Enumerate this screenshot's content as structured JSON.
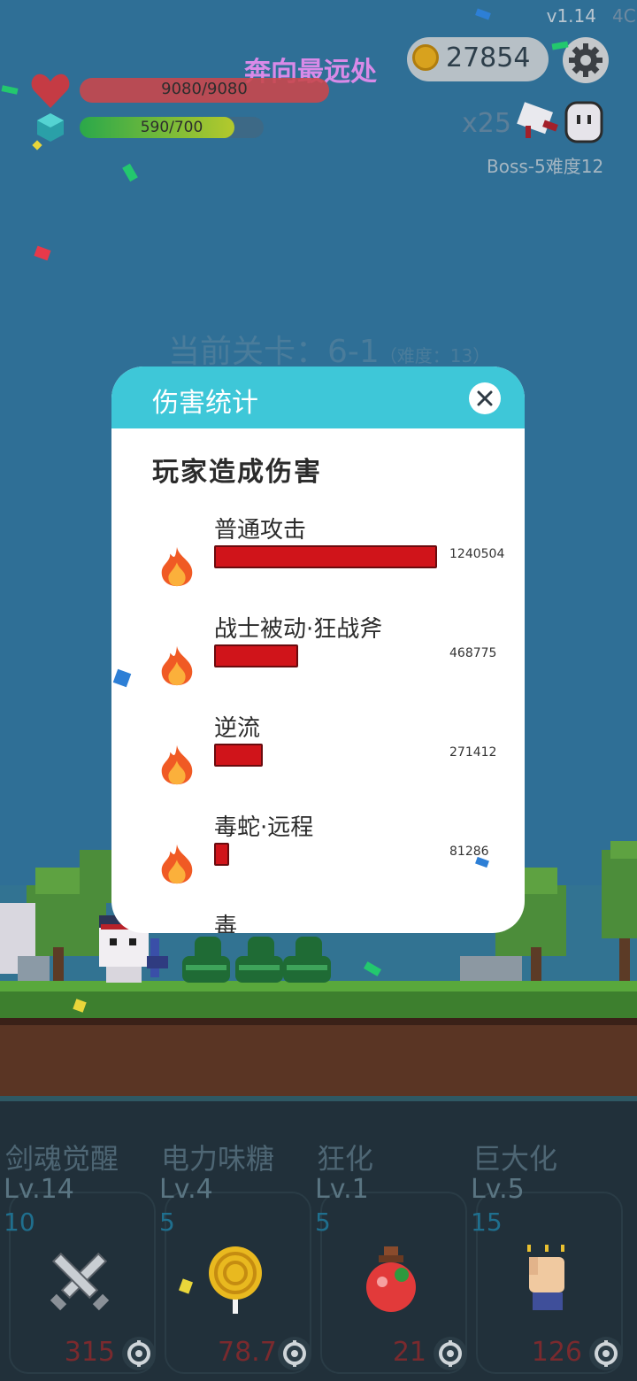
{
  "hud": {
    "version": "v1.14",
    "version_cut": "4C",
    "run_label": "奔向最远处",
    "coins": "27854",
    "hp_text": "9080/9080",
    "hp_fraction": 1.0,
    "mp_text": "590/700",
    "mp_fraction": 0.843,
    "combo": "x25",
    "boss_label": "Boss-5难度12"
  },
  "stage": {
    "label": "当前关卡：6-1",
    "difficulty": "（难度：13）"
  },
  "modal": {
    "title": "伤害统计",
    "section_title": "玩家造成伤害",
    "rows": [
      {
        "name": "普通攻击",
        "value": "1240504",
        "fraction": 1.0
      },
      {
        "name": "战士被动·狂战斧",
        "value": "468775",
        "fraction": 0.378
      },
      {
        "name": "逆流",
        "value": "271412",
        "fraction": 0.219
      },
      {
        "name": "毒蛇·远程",
        "value": "81286",
        "fraction": 0.066
      },
      {
        "name": "毒",
        "value": "",
        "fraction": 0
      }
    ]
  },
  "skills": [
    {
      "name": "剑魂觉醒",
      "level": "Lv.14",
      "cost": "10",
      "price": "315",
      "icon": "crossed-swords-icon"
    },
    {
      "name": "电力味糖",
      "level": "Lv.4",
      "cost": "5",
      "price": "78.7",
      "icon": "lollipop-icon"
    },
    {
      "name": "狂化",
      "level": "Lv.1",
      "cost": "5",
      "price": "21",
      "icon": "potion-icon"
    },
    {
      "name": "巨大化",
      "level": "Lv.5",
      "cost": "15",
      "price": "126",
      "icon": "fist-icon"
    }
  ],
  "colors": {
    "modal_header": "#3ec7d8",
    "damage_bar": "#d0141a",
    "hp_bar": "#c8474d",
    "run_label": "#d98ae8"
  }
}
